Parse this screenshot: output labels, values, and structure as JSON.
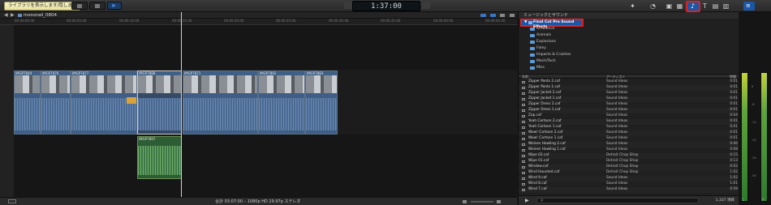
{
  "toolbar": {
    "library_button": "ライブラリを表示します/隠します",
    "timecode": "1:37:00",
    "browser_icon": "music-note-icon"
  },
  "timeline": {
    "project_name": "monorail_0804",
    "ruler_labels": [
      "00:00:00:00",
      "00:00:05:00",
      "00:00:10:00",
      "00:00:15:00",
      "00:00:20:00",
      "00:00:25:00",
      "00:00:30:00",
      "00:00:35:00",
      "00:00:40:00",
      "00:00:45:00"
    ],
    "clips": [
      {
        "label": "IMGP7844"
      },
      {
        "label": "IMGP7876"
      },
      {
        "label": "IMGP7877"
      },
      {
        "label": "IMGP7888"
      },
      {
        "label": "IMGP7871"
      },
      {
        "label": "IMGP7892"
      },
      {
        "label": "IMGP7883"
      }
    ],
    "connected_clip": "IMGP7897",
    "status": "合計 03:07:00 – 1080p HD 29.97p ステレオ"
  },
  "browser": {
    "title": "ミュージックとサウンド",
    "selected_library": "Final Cut Pro Sound Effects",
    "folders": [
      "Ambience",
      "Animals",
      "Explosions",
      "Foley",
      "Impacts & Crashes",
      "Mech/Tech",
      "Misc."
    ],
    "columns": {
      "name": "名前",
      "artist": "アーティスト",
      "time": "時間"
    },
    "rows": [
      {
        "name": "Zipper Pants 2.caf",
        "artist": "Sound Ideas",
        "time": "0:01"
      },
      {
        "name": "Zipper Pants 1.caf",
        "artist": "Sound Ideas",
        "time": "0:01"
      },
      {
        "name": "Zipper Jacket 2.caf",
        "artist": "Sound Ideas",
        "time": "0:01"
      },
      {
        "name": "Zipper Jacket 1.caf",
        "artist": "Sound Ideas",
        "time": "0:01"
      },
      {
        "name": "Zipper Dress 2.caf",
        "artist": "Sound Ideas",
        "time": "0:01"
      },
      {
        "name": "Zipper Dress 1.caf",
        "artist": "Sound Ideas",
        "time": "0:01"
      },
      {
        "name": "Zap.caf",
        "artist": "Sound Ideas",
        "time": "0:04"
      },
      {
        "name": "Yeah Cartoon 2.caf",
        "artist": "Sound Ideas",
        "time": "0:01"
      },
      {
        "name": "Yeah Cartoon 1.caf",
        "artist": "Sound Ideas",
        "time": "0:01"
      },
      {
        "name": "Wow! Cartoon 2.caf",
        "artist": "Sound Ideas",
        "time": "0:01"
      },
      {
        "name": "Wow! Cartoon 1.caf",
        "artist": "Sound Ideas",
        "time": "0:01"
      },
      {
        "name": "Wolves Howling 2.caf",
        "artist": "Sound Ideas",
        "time": "0:06"
      },
      {
        "name": "Wolves Howling 1.caf",
        "artist": "Sound Ideas",
        "time": "0:08"
      },
      {
        "name": "Wipe 02.caf",
        "artist": "Detroit Chop Shop",
        "time": "0:15"
      },
      {
        "name": "Wipe 01.caf",
        "artist": "Detroit Chop Shop",
        "time": "0:13"
      },
      {
        "name": "Window.caf",
        "artist": "Detroit Chop Shop",
        "time": "0:02"
      },
      {
        "name": "Wind Haunted.caf",
        "artist": "Detroit Chop Shop",
        "time": "1:02"
      },
      {
        "name": "Wind 9.caf",
        "artist": "Sound Ideas",
        "time": "1:02"
      },
      {
        "name": "Wind 8.caf",
        "artist": "Sound Ideas",
        "time": "1:01"
      },
      {
        "name": "Wind 7.caf",
        "artist": "Sound Ideas",
        "time": "0:59"
      }
    ],
    "count": "1,337 項目"
  },
  "meter": {
    "ticks": [
      "0",
      "-6",
      "-12",
      "-20",
      "-30",
      "-50"
    ],
    "labels": [
      "L",
      "R"
    ]
  }
}
